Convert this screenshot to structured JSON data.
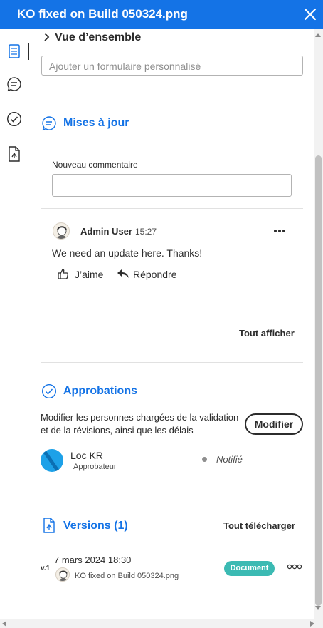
{
  "header": {
    "title": "KO fixed on Build 050324.png",
    "close_icon": "close-icon"
  },
  "rail": {
    "items": [
      "document-icon",
      "comment-icon",
      "check-circle-icon",
      "file-share-icon"
    ]
  },
  "overview": {
    "label": "Vue d’ensemble",
    "custom_form_placeholder": "Ajouter un formulaire personnalisé"
  },
  "updates": {
    "title": "Mises à jour",
    "new_comment_label": "Nouveau commentaire",
    "new_comment_value": "",
    "comments": [
      {
        "author": "Admin User",
        "time": "15:27",
        "text": "We need an update here. Thanks!",
        "like_label": "J’aime",
        "reply_label": "Répondre"
      }
    ],
    "show_all": "Tout afficher"
  },
  "approvals": {
    "title": "Approbations",
    "description": "Modifier les personnes chargées de la validation et de la révisions, ainsi que les délais",
    "modify_button": "Modifier",
    "approvers": [
      {
        "name": "Loc KR",
        "role": "Approbateur",
        "status": "Notifié"
      }
    ]
  },
  "versions": {
    "title": "Versions (1)",
    "download_all": "Tout télécharger",
    "items": [
      {
        "label": "v.1",
        "date": "7 mars 2024 18:30",
        "file": "KO fixed on Build 050324.png",
        "badge": "Document"
      }
    ]
  },
  "colors": {
    "accent": "#1473e6",
    "badge": "#3bbab3",
    "approver_avatar": "#1da1e8"
  }
}
